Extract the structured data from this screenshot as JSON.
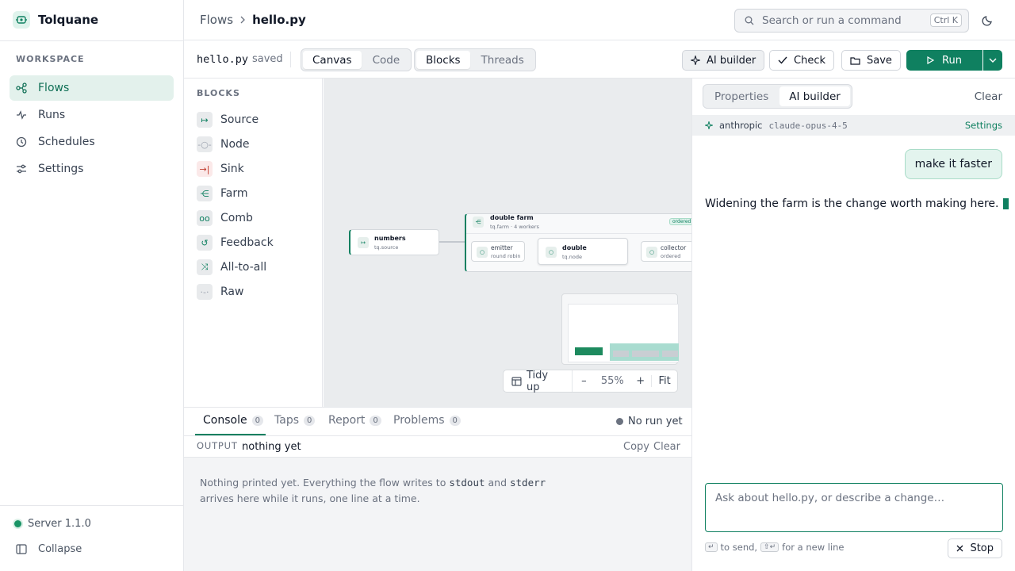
{
  "app": {
    "name": "Tolquane"
  },
  "sidebar": {
    "section_label": "WORKSPACE",
    "items": [
      {
        "label": "Flows",
        "icon": "flows-icon",
        "active": true
      },
      {
        "label": "Runs",
        "icon": "pulse-icon"
      },
      {
        "label": "Schedules",
        "icon": "clock-icon"
      },
      {
        "label": "Settings",
        "icon": "sliders-icon"
      }
    ],
    "server_label": "Server 1.1.0",
    "collapse_label": "Collapse"
  },
  "header": {
    "breadcrumb_root": "Flows",
    "breadcrumb_current": "hello.py",
    "search_placeholder": "Search or run a command",
    "search_shortcut": "Ctrl K"
  },
  "toolbar": {
    "file_name": "hello.py",
    "file_status": "saved",
    "view_tabs": [
      "Canvas",
      "Code"
    ],
    "active_view": "Canvas",
    "mode_tabs": [
      "Blocks",
      "Threads"
    ],
    "active_mode": "Blocks",
    "ai_builder_label": "AI builder",
    "check_label": "Check",
    "save_label": "Save",
    "run_label": "Run"
  },
  "palette": {
    "title": "BLOCKS",
    "blocks": [
      "Source",
      "Node",
      "Sink",
      "Farm",
      "Comb",
      "Feedback",
      "All-to-all",
      "Raw"
    ]
  },
  "canvas": {
    "source_node": {
      "title": "numbers",
      "subtitle": "tq.source"
    },
    "farm": {
      "title": "double farm",
      "subtitle": "tq.farm · 4 workers",
      "badge": "ordered"
    },
    "emitter": {
      "title": "emitter",
      "subtitle": "round robin"
    },
    "worker": {
      "title": "double",
      "subtitle": "tq.node"
    },
    "collector": {
      "title": "collector",
      "subtitle": "ordered"
    },
    "zoom": {
      "tidy_label": "Tidy up",
      "minus": "–",
      "level": "55%",
      "plus": "+",
      "fit_label": "Fit"
    }
  },
  "console": {
    "tabs": [
      {
        "label": "Console",
        "count": "0"
      },
      {
        "label": "Taps",
        "count": "0"
      },
      {
        "label": "Report",
        "count": "0"
      },
      {
        "label": "Problems",
        "count": "0"
      }
    ],
    "run_status": "No run yet",
    "output_label": "OUTPUT",
    "output_value": "nothing yet",
    "copy_label": "Copy",
    "clear_label": "Clear",
    "empty_text_1": "Nothing printed yet. Everything the flow writes to",
    "stdout": "stdout",
    "and": "and",
    "stderr": "stderr",
    "empty_text_2": "arrives here while it runs, one line at a time."
  },
  "panel": {
    "tabs": [
      "Properties",
      "AI builder"
    ],
    "active_tab": "AI builder",
    "clear_label": "Clear",
    "provider": "anthropic",
    "model": "claude-opus-4-5",
    "settings_label": "Settings",
    "user_message": "make it faster",
    "assistant_message": "Widening the farm is the change worth making here.",
    "input_placeholder": "Ask about hello.py, or describe a change…",
    "hint_send": "to send,",
    "hint_newline": "for a new line",
    "stop_label": "Stop"
  },
  "colors": {
    "accent": "#0f8060",
    "accent_light": "#e3f1ec",
    "canvas_bg": "#eaecee"
  }
}
